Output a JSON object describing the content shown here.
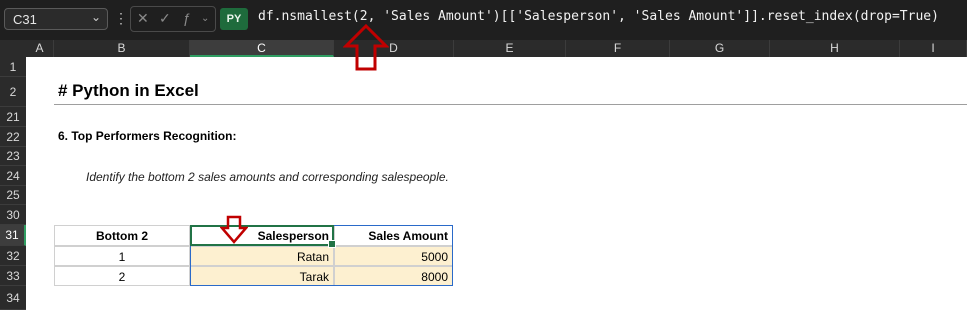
{
  "name_box": {
    "value": "C31"
  },
  "formula_bar": {
    "py_badge": "PY",
    "formula": "df.nsmallest(2, 'Sales Amount')[['Salesperson', 'Sales Amount']].reset_index(drop=True)",
    "more_icon": "⋮",
    "cancel_icon": "✕",
    "enter_icon": "✓",
    "function_icon": "ƒ"
  },
  "columns": [
    "A",
    "B",
    "C",
    "D",
    "E",
    "F",
    "G",
    "H",
    "I"
  ],
  "rows": [
    "1",
    "2",
    "21",
    "22",
    "23",
    "24",
    "25",
    "30",
    "31",
    "32",
    "33",
    "34"
  ],
  "sheet": {
    "heading": "# Python in Excel",
    "subtitle": "6. Top Performers Recognition:",
    "description": "Identify the  bottom 2 sales amounts and corresponding salespeople."
  },
  "table": {
    "headers": [
      "Bottom 2",
      "Salesperson",
      "Sales Amount"
    ],
    "rows": [
      {
        "rank": "1",
        "salesperson": "Ratan",
        "amount": "5000"
      },
      {
        "rank": "2",
        "salesperson": "Tarak",
        "amount": "8000"
      }
    ]
  },
  "colors": {
    "accent": "#217346",
    "annotation_arrow": "#c00000",
    "py_fill": "#fdf0d0"
  }
}
